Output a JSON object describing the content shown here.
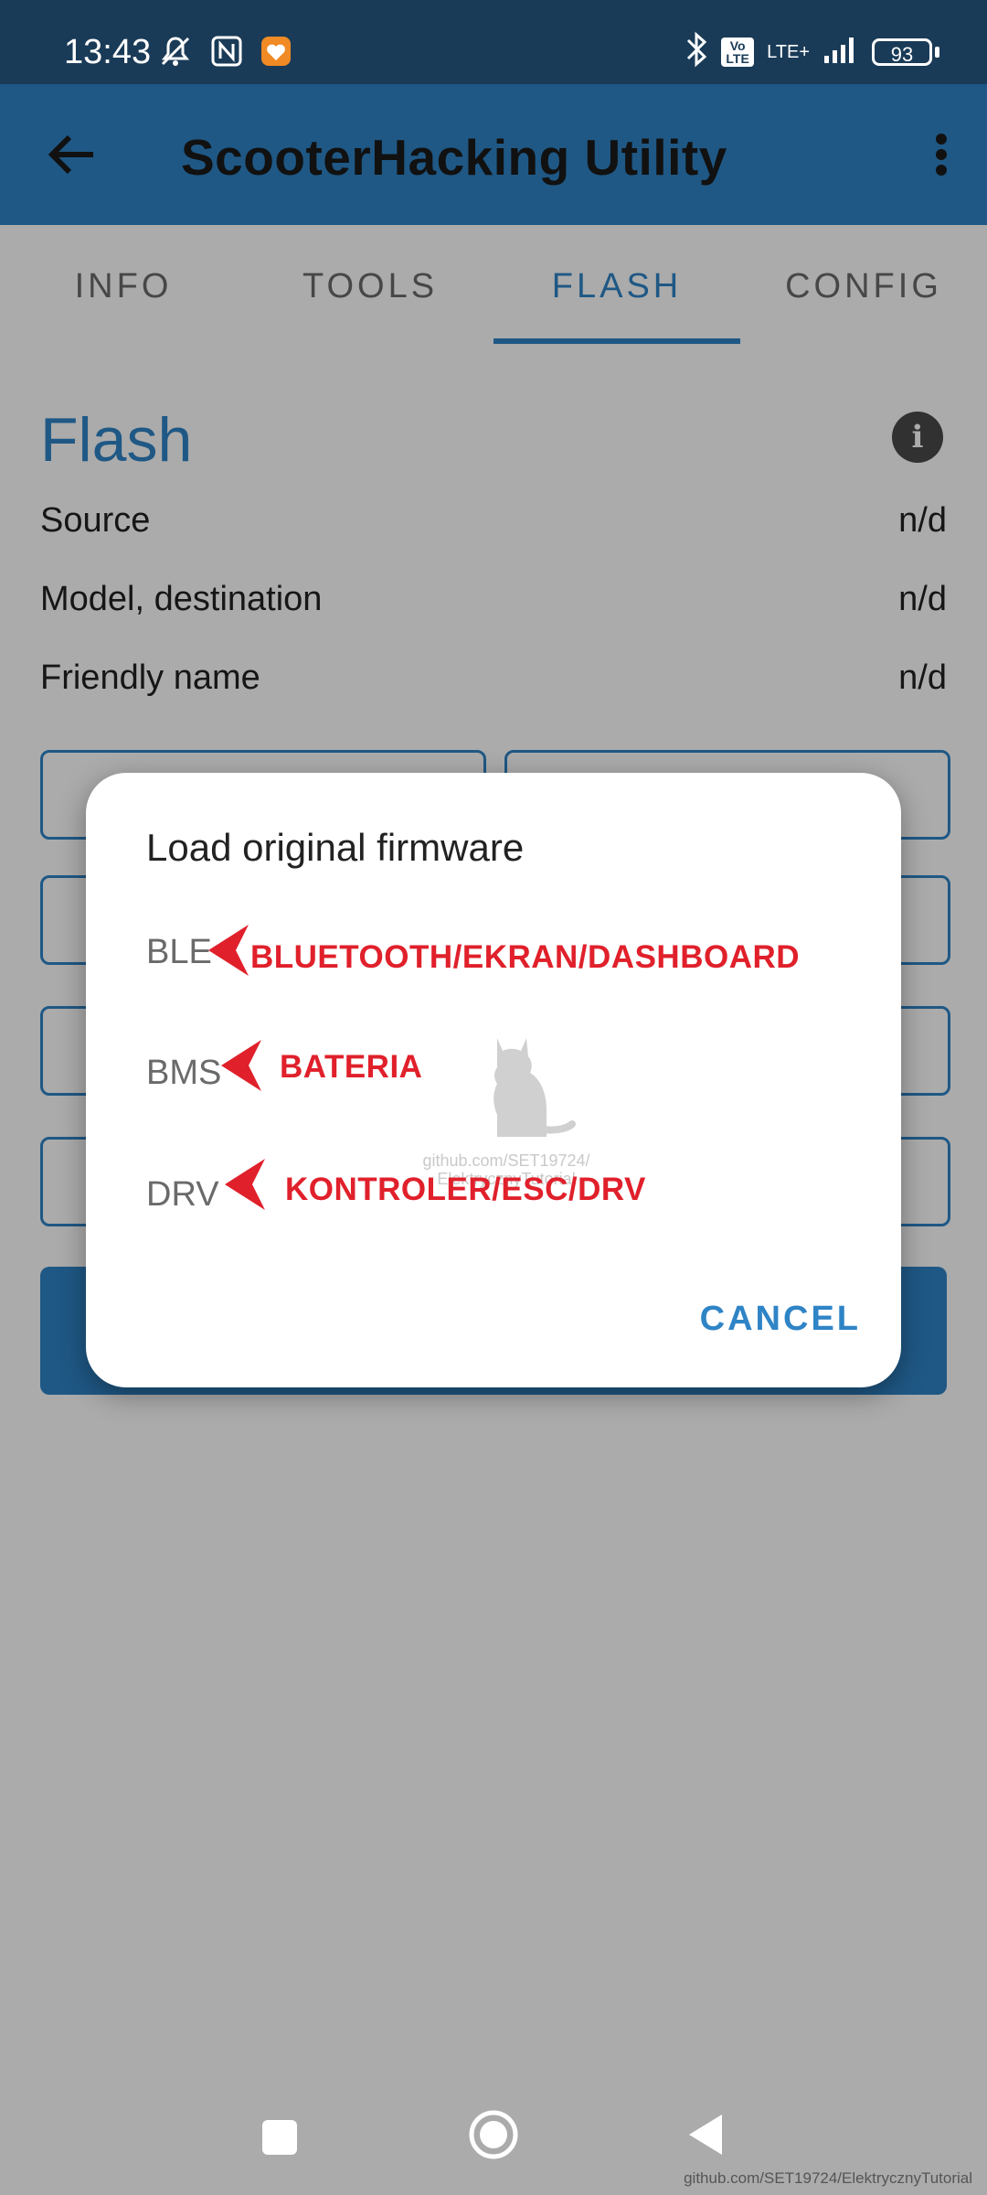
{
  "status_bar": {
    "time": "13:43",
    "volte": "Vo LTE",
    "network": "LTE+",
    "battery": "93"
  },
  "app_bar": {
    "title": "ScooterHacking Utility"
  },
  "tabs": [
    {
      "label": "INFO"
    },
    {
      "label": "TOOLS"
    },
    {
      "label": "FLASH",
      "active": true
    },
    {
      "label": "CONFIG"
    }
  ],
  "flash": {
    "title": "Flash",
    "rows": [
      {
        "label": "Source",
        "value": "n/d"
      },
      {
        "label": "Model, destination",
        "value": "n/d"
      },
      {
        "label": "Friendly name",
        "value": "n/d"
      }
    ]
  },
  "dialog": {
    "title": "Load original firmware",
    "options": [
      {
        "label": "BLE",
        "annotation": "BLUETOOTH/EKRAN/DASHBOARD"
      },
      {
        "label": "BMS",
        "annotation": "BATERIA"
      },
      {
        "label": "DRV",
        "annotation": "KONTROLER/ESC/DRV"
      }
    ],
    "cancel_label": "CANCEL",
    "watermark_line1": "github.com/SET19724/",
    "watermark_line2": "ElektrycznyTutorial"
  },
  "footer_credit": "github.com/SET19724/ElektrycznyTutorial",
  "colors": {
    "status_bar": "#1a3b57",
    "app_bar": "#2f84c6",
    "accent": "#2f84c6",
    "annotation_red": "#e0202b"
  }
}
